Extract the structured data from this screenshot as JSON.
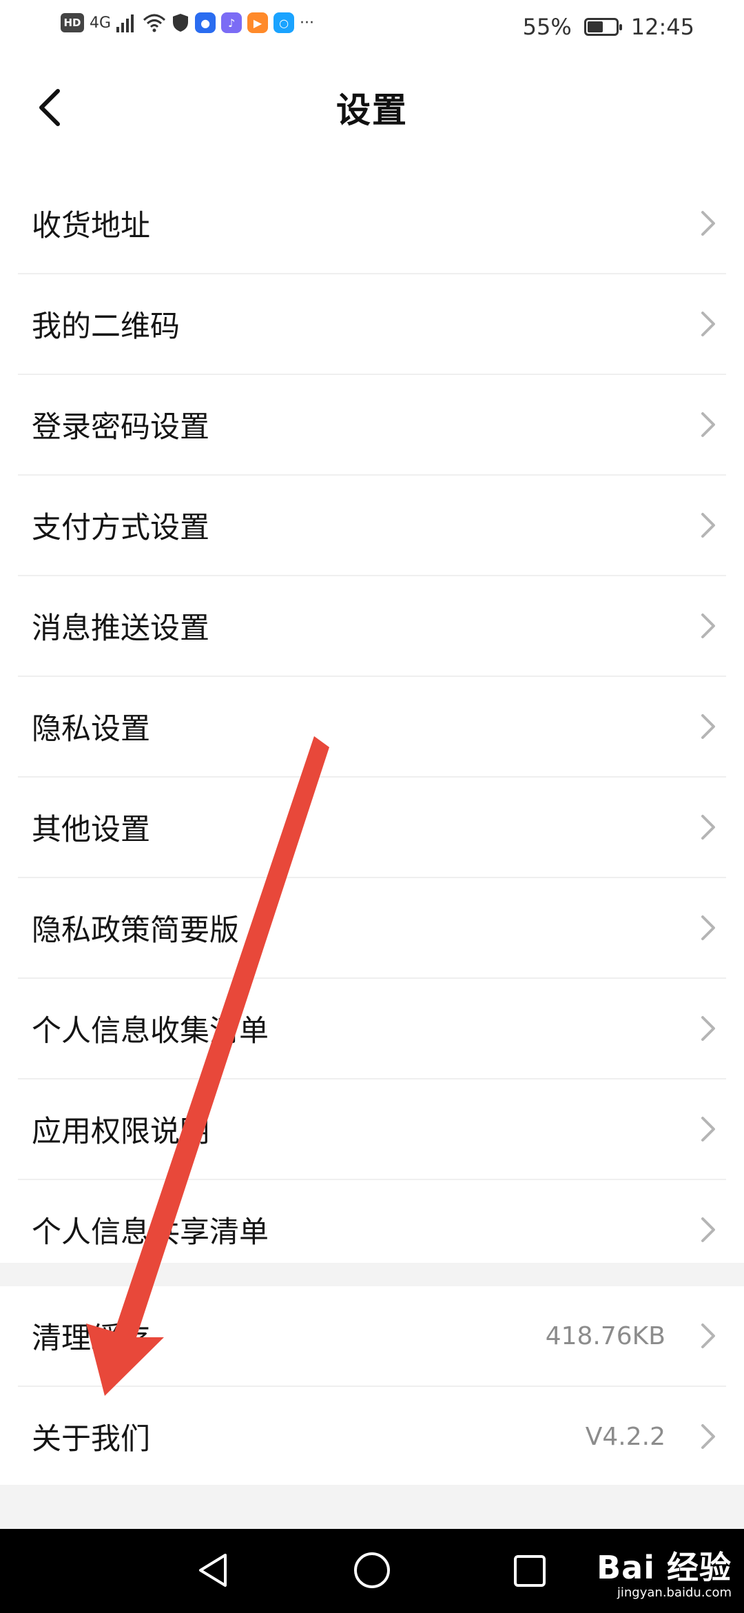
{
  "status_bar": {
    "hd": "HD",
    "network": "4G",
    "more": "···",
    "battery": "55%",
    "battery_level": 0.55,
    "time": "12:45"
  },
  "header": {
    "title": "设置"
  },
  "settings": [
    {
      "label": "收货地址",
      "value": ""
    },
    {
      "label": "我的二维码",
      "value": ""
    },
    {
      "label": "登录密码设置",
      "value": ""
    },
    {
      "label": "支付方式设置",
      "value": ""
    },
    {
      "label": "消息推送设置",
      "value": ""
    },
    {
      "label": "隐私设置",
      "value": ""
    },
    {
      "label": "其他设置",
      "value": ""
    },
    {
      "label": "隐私政策简要版",
      "value": ""
    },
    {
      "label": "个人信息收集清单",
      "value": ""
    },
    {
      "label": "应用权限说明",
      "value": ""
    },
    {
      "label": "个人信息共享清单",
      "value": ""
    }
  ],
  "settings2": [
    {
      "label": "清理缓存",
      "value": "418.76KB"
    },
    {
      "label": "关于我们",
      "value": "V4.2.2"
    }
  ],
  "watermark": {
    "main": "Bai 经验",
    "sub": "jingyan.baidu.com"
  },
  "colors": {
    "annotation_arrow": "#e8483a"
  }
}
